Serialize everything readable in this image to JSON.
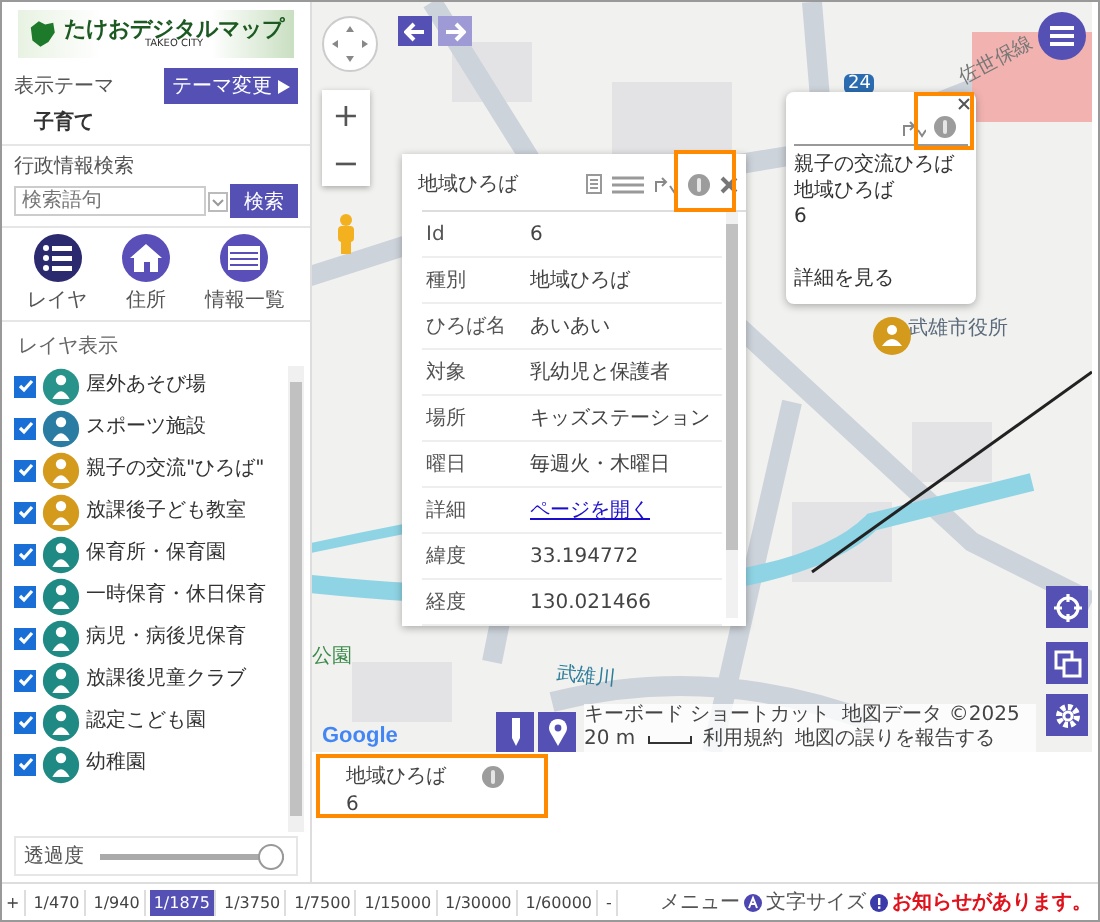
{
  "logo": {
    "title": "たけおデジタルマップ",
    "subtitle": "TAKEO CITY"
  },
  "theme": {
    "label": "表示テーマ",
    "button": "テーマ変更",
    "value": "子育て"
  },
  "search": {
    "label": "行政情報検索",
    "placeholder": "検索語句",
    "button": "検索"
  },
  "nav": [
    {
      "kind": "layers",
      "label": "レイヤ",
      "selected": true
    },
    {
      "kind": "home",
      "label": "住所",
      "selected": false
    },
    {
      "kind": "list",
      "label": "情報一覧",
      "selected": false
    }
  ],
  "layers": {
    "title": "レイヤ表示",
    "items": [
      {
        "label": "屋外あそび場",
        "checked": true,
        "color": "#27938a"
      },
      {
        "label": "スポーツ施設",
        "checked": true,
        "color": "#2a7ca3"
      },
      {
        "label": "親子の交流\"ひろば\"",
        "checked": true,
        "color": "#d49a1c"
      },
      {
        "label": "放課後子ども教室",
        "checked": true,
        "color": "#d49a1c"
      },
      {
        "label": "保育所・保育園",
        "checked": true,
        "color": "#1f8a84"
      },
      {
        "label": "一時保育・休日保育",
        "checked": true,
        "color": "#1f8a84"
      },
      {
        "label": "病児・病後児保育",
        "checked": true,
        "color": "#1f8a84"
      },
      {
        "label": "放課後児童クラブ",
        "checked": true,
        "color": "#1f8a84"
      },
      {
        "label": "認定こども園",
        "checked": true,
        "color": "#1f8a84"
      },
      {
        "label": "幼稚園",
        "checked": true,
        "color": "#1f8a84"
      }
    ]
  },
  "opacity": {
    "label": "透過度",
    "level": 1
  },
  "map": {
    "zoom_in": "+",
    "zoom_out": "−",
    "forward_disabled": true,
    "labels": [
      "24",
      "佐世保線",
      "武雄川",
      "公園",
      "武雄市役所"
    ],
    "google": "Google",
    "attribution": [
      "キーボード ショートカット",
      "地図データ ©2025",
      "20 m",
      "利用規約",
      "地図の誤りを報告する"
    ],
    "detail": {
      "title": "地域ひろば",
      "rows": [
        {
          "key": "Id",
          "value": "6",
          "kind": "text"
        },
        {
          "key": "種別",
          "value": "地域ひろば",
          "kind": "text"
        },
        {
          "key": "ひろば名",
          "value": "あいあい",
          "kind": "text"
        },
        {
          "key": "対象",
          "value": "乳幼児と保護者",
          "kind": "text"
        },
        {
          "key": "場所",
          "value": "キッズステーション",
          "kind": "text"
        },
        {
          "key": "曜日",
          "value": "毎週火・木曜日",
          "kind": "text"
        },
        {
          "key": "詳細",
          "value": "ページを開く",
          "kind": "link"
        },
        {
          "key": "緯度",
          "value": "33.194772",
          "kind": "text"
        },
        {
          "key": "経度",
          "value": "130.021466",
          "kind": "text"
        }
      ]
    },
    "callout": {
      "lines": [
        "親子の交流ひろば",
        "地域ひろば",
        "6"
      ],
      "link": "詳細を見る"
    }
  },
  "info_box": {
    "title": "地域ひろば",
    "value": "6"
  },
  "footer": {
    "zoom_in": "+",
    "zoom_out": "-",
    "scales": [
      {
        "label": "1/470",
        "selected": false
      },
      {
        "label": "1/940",
        "selected": false
      },
      {
        "label": "1/1875",
        "selected": true
      },
      {
        "label": "1/3750",
        "selected": false
      },
      {
        "label": "1/7500",
        "selected": false
      },
      {
        "label": "1/15000",
        "selected": false
      },
      {
        "label": "1/30000",
        "selected": false
      },
      {
        "label": "1/60000",
        "selected": false
      }
    ],
    "menu": "メニュー",
    "font_size": "文字サイズ",
    "notice": "お知らせがあります。"
  }
}
